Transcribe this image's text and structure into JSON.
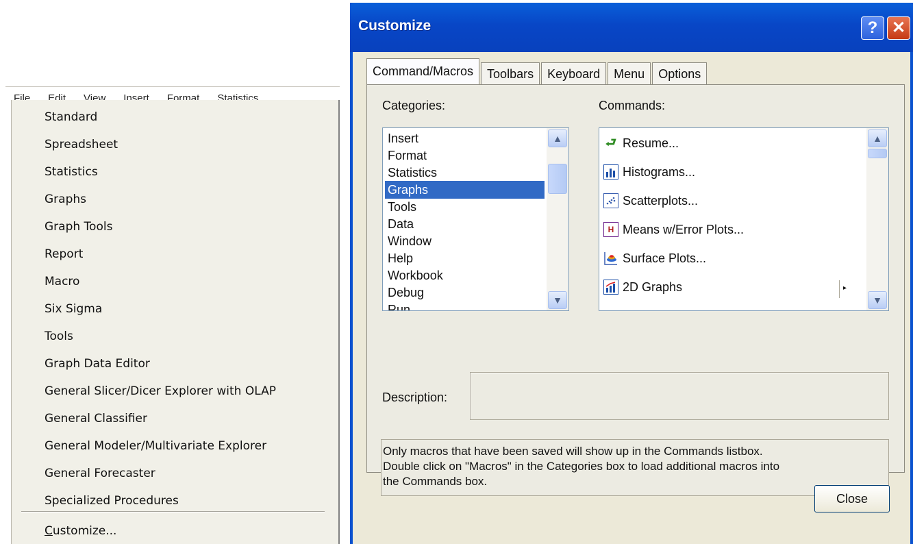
{
  "menubar": {
    "items": [
      "File",
      "Edit",
      "View",
      "Insert",
      "Format",
      "Statistics"
    ]
  },
  "toolbar_menu": {
    "items": [
      "Standard",
      "Spreadsheet",
      "Statistics",
      "Graphs",
      "Graph Tools",
      "Report",
      "Macro",
      "Six Sigma",
      "Tools",
      "Graph Data Editor",
      "General Slicer/Dicer Explorer with OLAP",
      "General Classifier",
      "General Modeler/Multivariate Explorer",
      "General Forecaster",
      "Specialized Procedures"
    ],
    "customize": {
      "accel": "C",
      "rest": "ustomize..."
    }
  },
  "dialog": {
    "title": "Customize",
    "help_glyph": "?",
    "close_glyph": "✕",
    "tabs": [
      "Command/Macros",
      "Toolbars",
      "Keyboard",
      "Menu",
      "Options"
    ],
    "active_tab": "Command/Macros",
    "categories_label": "Categories:",
    "commands_label": "Commands:",
    "categories": [
      "Insert",
      "Format",
      "Statistics",
      "Graphs",
      "Tools",
      "Data",
      "Window",
      "Help",
      "Workbook",
      "Debug",
      "Run"
    ],
    "selected_category": "Graphs",
    "commands": [
      {
        "label": "Resume...",
        "icon": "green-arrow-icon"
      },
      {
        "label": "Histograms...",
        "icon": "histogram-icon"
      },
      {
        "label": "Scatterplots...",
        "icon": "scatterplot-icon"
      },
      {
        "label": "Means w/Error Plots...",
        "icon": "error-plot-icon"
      },
      {
        "label": "Surface Plots...",
        "icon": "surface-plot-icon"
      },
      {
        "label": "2D Graphs",
        "icon": "2d-graph-icon"
      }
    ],
    "description_label": "Description:",
    "info_text": "Only macros that have been saved will show up in the Commands listbox. Double click on \"Macros\" in the Categories box to load additional macros into the Commands box.",
    "info_lines": [
      "Only macros that have been saved will show up in the Commands listbox.",
      "Double click on \"Macros\" in the Categories box to load additional macros into",
      "the Commands box."
    ],
    "close_button": "Close"
  }
}
